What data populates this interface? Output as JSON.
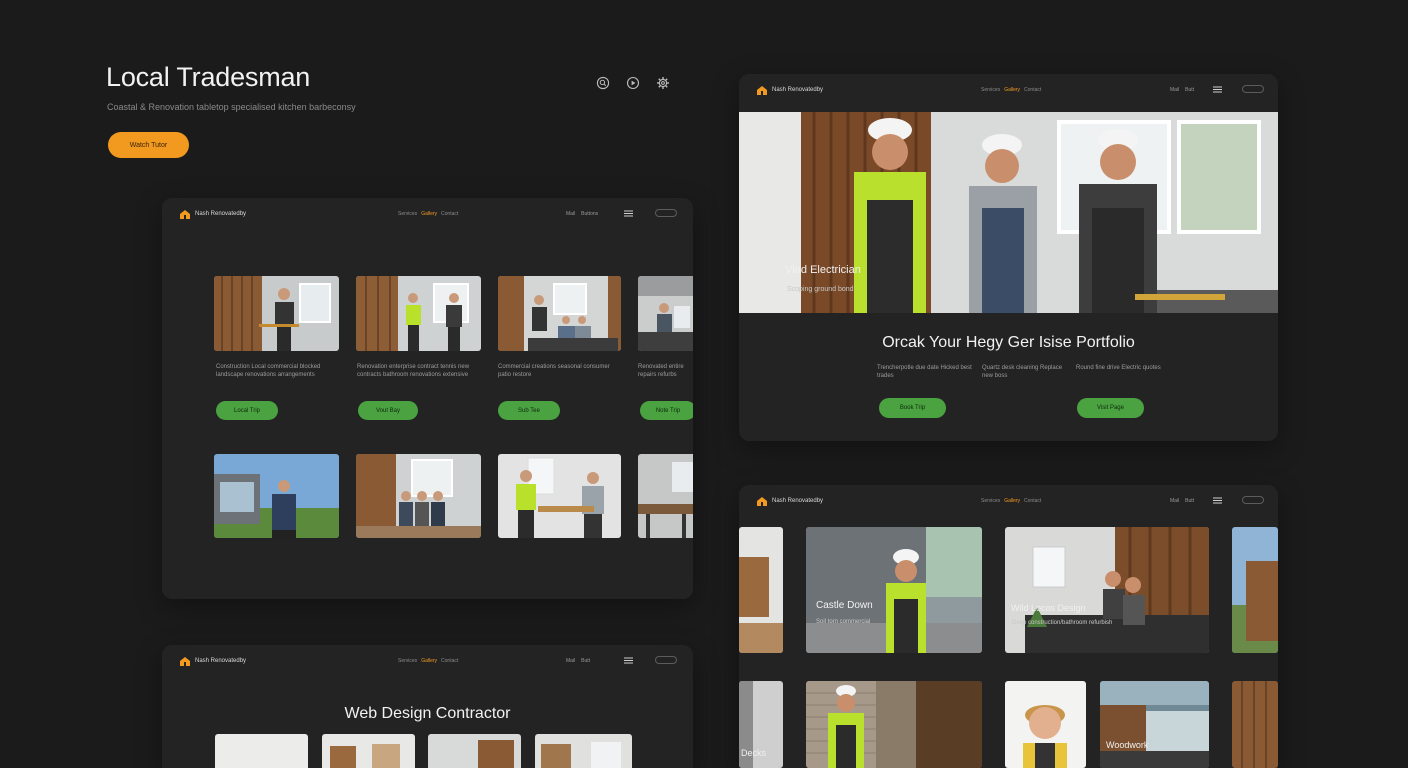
{
  "hero": {
    "title": "Local Tradesman",
    "subtitle": "Coastal & Renovation tabletop specialised kitchen barbeconsy",
    "cta": "Watch Tutor"
  },
  "top_icons": [
    "search-icon",
    "play-icon",
    "gear-icon"
  ],
  "brand": "Nash Renovatedby",
  "nav": {
    "links": [
      "Services",
      "Gallery",
      "Contact"
    ],
    "active_index": 1,
    "right_items": [
      "Mail",
      "Buttons"
    ],
    "right_items_short": [
      "Mail",
      "Butt"
    ]
  },
  "panel_gallery": {
    "cards": [
      {
        "text": "Construction Local commercial blocked landscape renovations arrangements",
        "button": "Local Trip"
      },
      {
        "text": "Renovation enterprise contract tennis new contracts bathroom renovations extensive",
        "button": "Vout Bay"
      },
      {
        "text": "Commercial creations seasonal consumer patio restore",
        "button": "Sub Tee"
      },
      {
        "text": "Renovated entire repairs refurbs",
        "button": "Note Trip"
      }
    ]
  },
  "panel_hero": {
    "overlay_title": "Vlad Electrician",
    "overlay_sub": "Scoping ground bond",
    "headline": "Orcak Your Hegy Ger Isise Portfolio",
    "columns": [
      {
        "text": "Trencherpotle due date Hicked best trades"
      },
      {
        "text": "Quartz desk cleaning Replace new boss"
      },
      {
        "text": "Round fine drive Electric quotes"
      }
    ],
    "buttons": [
      "Book Trip",
      "Visit Page"
    ]
  },
  "panel_showcase": {
    "card_a": {
      "title": "Castle Down",
      "sub": "Soil torn commercial"
    },
    "card_b": {
      "title": "Wild Locos Design",
      "sub": "Deep construction/bathroom refurbish"
    },
    "bottom_labels": [
      "Decks",
      "Woodwork"
    ]
  },
  "panel_contractor": {
    "title": "Web Design Contractor"
  }
}
